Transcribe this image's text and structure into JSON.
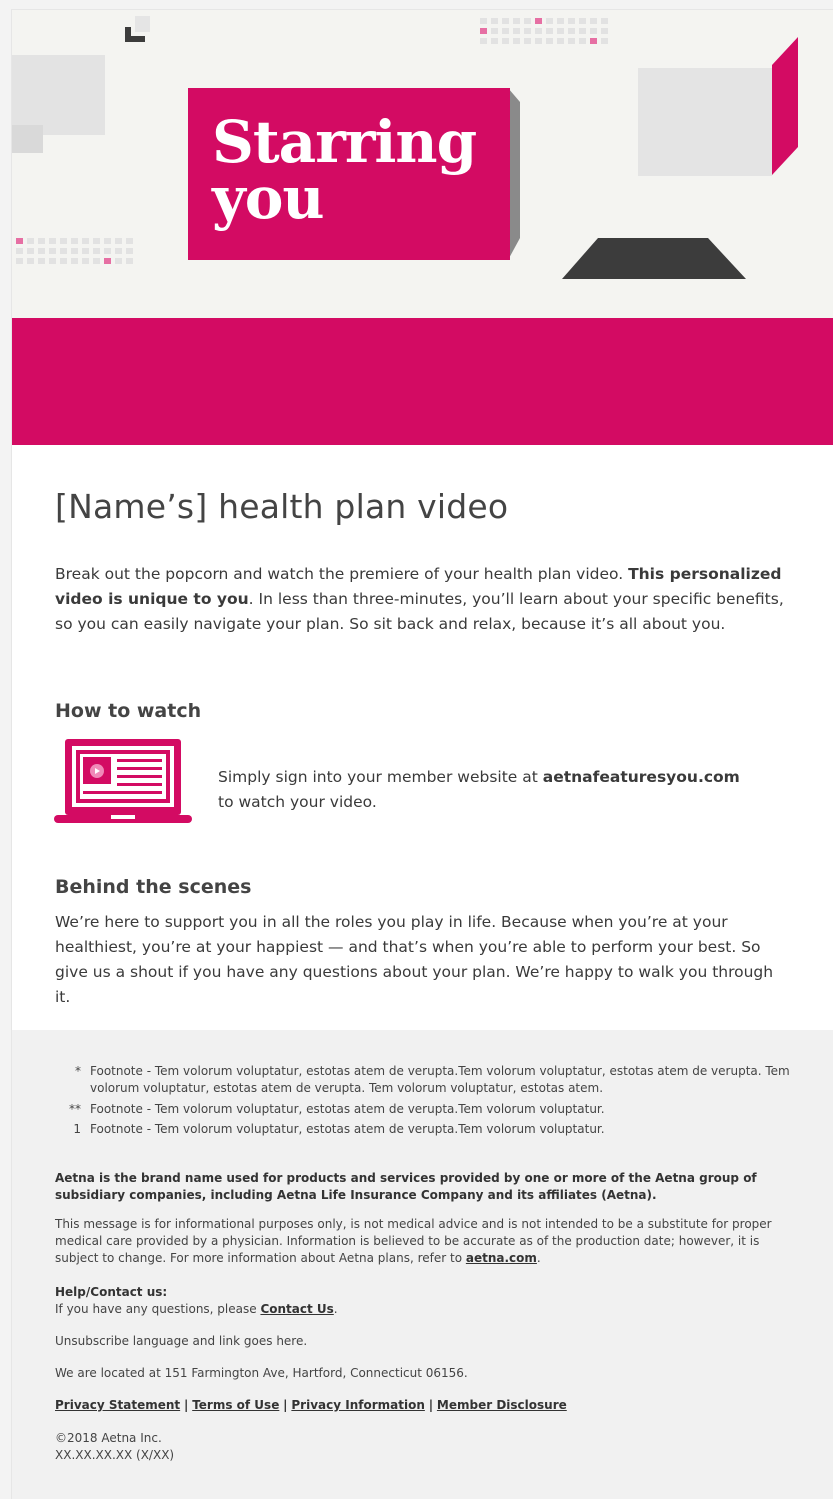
{
  "hero": {
    "title_line1": "Starring",
    "title_line2": "you",
    "colors": {
      "brand": "#d30b63",
      "dark": "#3c3c3c",
      "light_gray": "#e3e3e3"
    }
  },
  "main": {
    "heading": "[Name’s] health plan video",
    "intro_1": "Break out the popcorn and watch the premiere of your health plan video. ",
    "intro_bold": "This personalized video is unique to you",
    "intro_2": ". In less than three-minutes, you’ll learn about your specific benefits, so you can easily navigate your plan. So sit back and relax, because it’s all about you.",
    "how_heading": "How to watch",
    "how_text_1": "Simply sign into your member website at ",
    "how_link": "aetnafeaturesyou.com",
    "how_text_2": " to watch your video.",
    "laptop_icon": "laptop-video-icon",
    "behind_heading": "Behind the scenes",
    "behind_text": "We’re here to support you in all the roles you play in life. Because when you’re at your healthiest, you’re at your happiest — and that’s when you’re able to perform your best. So give us a shout if you have any questions about your plan. We’re happy to walk you through it."
  },
  "footer": {
    "footnotes": [
      {
        "mark": "*",
        "text": "Footnote - Tem volorum voluptatur, estotas atem de verupta.Tem volorum voluptatur, estotas atem de verupta. Tem volorum voluptatur, estotas atem de verupta. Tem volorum voluptatur, estotas atem."
      },
      {
        "mark": "**",
        "text": "Footnote - Tem volorum voluptatur, estotas atem de verupta.Tem volorum voluptatur."
      },
      {
        "mark": "1",
        "text": "Footnote - Tem volorum voluptatur, estotas atem de verupta.Tem volorum voluptatur."
      }
    ],
    "brand_statement": "Aetna is the brand name used for products and services provided by one or more of the Aetna group of subsidiary companies, including Aetna Life Insurance Company and its affiliates (Aetna).",
    "disclaimer_1": "This message is for informational purposes only, is not medical advice and is not intended to be a substitute for proper medical care provided by a physician. Information is believed to be accurate as of the production date; however, it is subject to change. For more information about Aetna plans, refer to ",
    "disclaimer_link": "aetna.com",
    "disclaimer_2": ".",
    "help_heading": "Help/Contact us:",
    "help_text_1": "If you have any questions, please ",
    "help_link": "Contact Us",
    "help_text_2": ".",
    "unsubscribe": "Unsubscribe language and link goes here.",
    "address": "We are located at 151 Farmington Ave, Hartford, Connecticut 06156.",
    "links": [
      "Privacy Statement",
      "Terms of Use",
      "Privacy Information",
      "Member Disclosure"
    ],
    "separator": "|",
    "copyright": "©2018 Aetna Inc.",
    "code": "XX.XX.XX.XX  (X/XX)"
  }
}
